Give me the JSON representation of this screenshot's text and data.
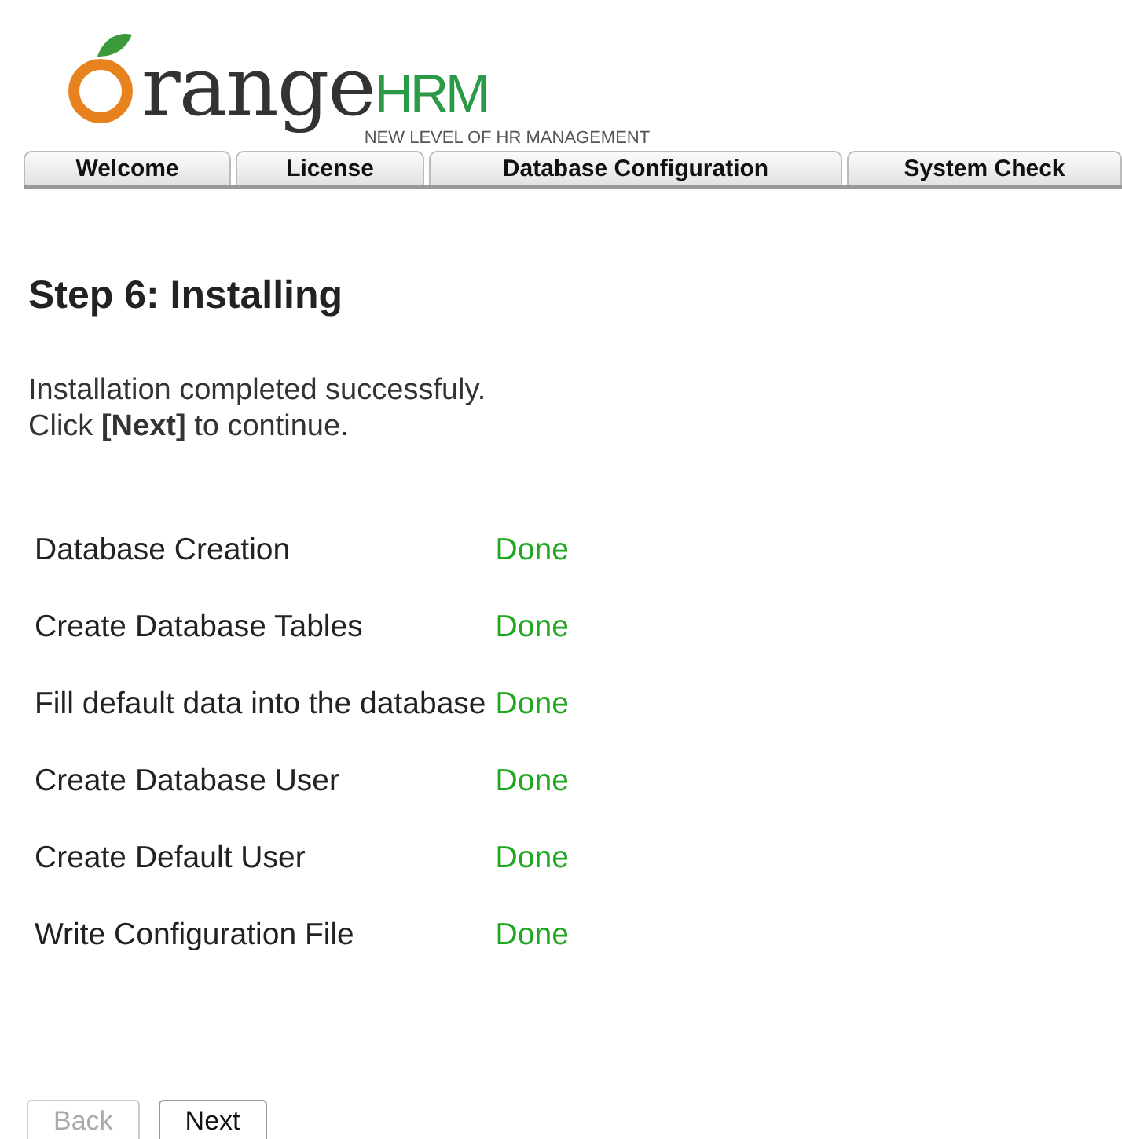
{
  "logo": {
    "word": "range",
    "suffix": "HRM",
    "tagline": "NEW LEVEL OF HR MANAGEMENT"
  },
  "tabs": [
    {
      "label": "Welcome",
      "selected": false
    },
    {
      "label": "License",
      "selected": false
    },
    {
      "label": "Database Configuration",
      "selected": false
    },
    {
      "label": "System Check",
      "selected": false
    }
  ],
  "heading": "Step 6: Installing",
  "message": [
    "Installation completed successfuly.",
    "Click **[Next]** to continue."
  ],
  "steps": [
    {
      "task": "Database Creation",
      "status": "Done"
    },
    {
      "task": "Create Database Tables",
      "status": "Done"
    },
    {
      "task": "Fill default data into the database",
      "status": "Done"
    },
    {
      "task": "Create Database User",
      "status": "Done"
    },
    {
      "task": "Create Default User",
      "status": "Done"
    },
    {
      "task": "Write Configuration File",
      "status": "Done"
    }
  ],
  "buttons": [
    {
      "label": "Back",
      "disabled": true
    },
    {
      "label": "Next",
      "disabled": false
    }
  ]
}
